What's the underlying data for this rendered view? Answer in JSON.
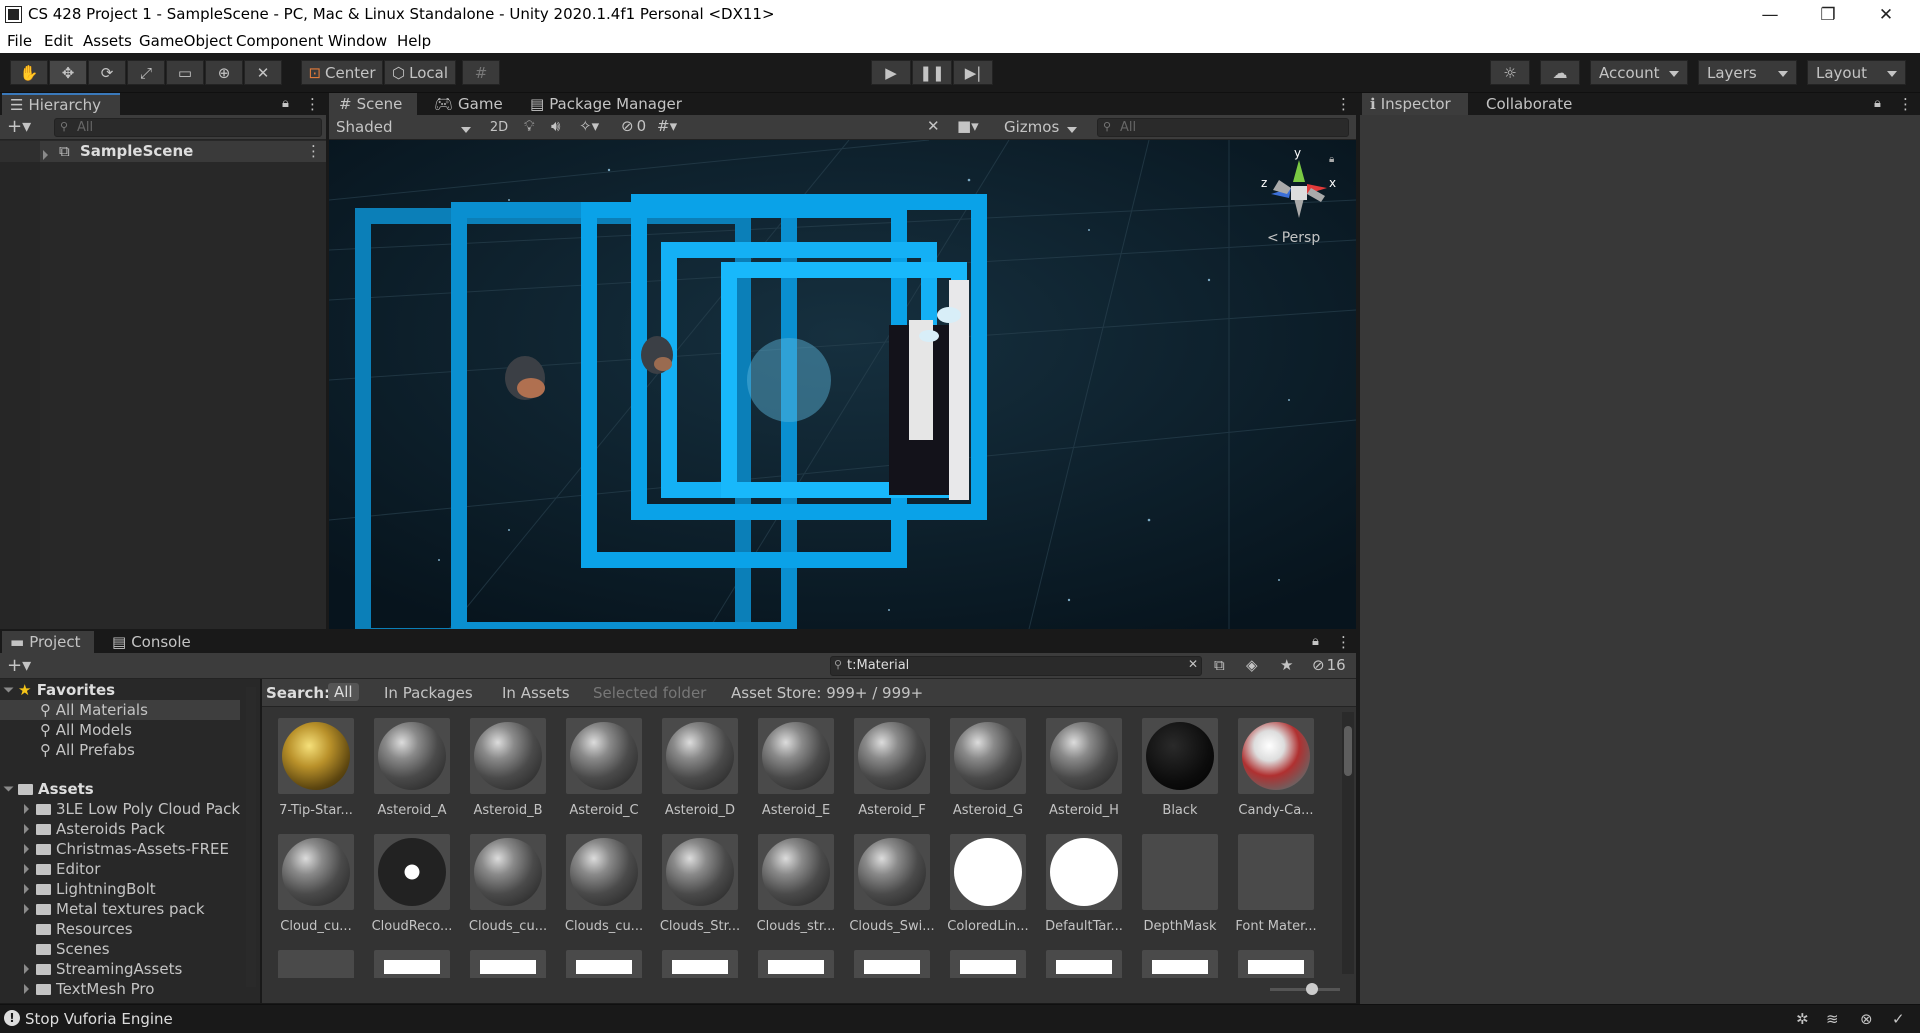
{
  "window": {
    "title": "CS 428 Project 1 - SampleScene - PC, Mac & Linux Standalone - Unity 2020.1.4f1 Personal <DX11>",
    "minimize": "—",
    "maximize": "❐",
    "close": "✕"
  },
  "menu": [
    "File",
    "Edit",
    "Assets",
    "GameObject",
    "Component",
    "Window",
    "Help"
  ],
  "toolbar": {
    "pivot_label": "Center",
    "space_label": "Local",
    "account": "Account",
    "layers": "Layers",
    "layout": "Layout"
  },
  "hierarchy": {
    "tab": "Hierarchy",
    "search_placeholder": "All",
    "scene": "SampleScene"
  },
  "scene_tabs": [
    "Scene",
    "Game",
    "Package Manager"
  ],
  "scene_bar": {
    "shading": "Shaded",
    "mode2d": "2D",
    "hidden_count": "0",
    "gizmos": "Gizmos",
    "search_placeholder": "All"
  },
  "gizmo": {
    "y": "y",
    "x": "x",
    "z": "z",
    "persp": "Persp"
  },
  "inspector": {
    "tabs": [
      "Inspector",
      "Collaborate"
    ]
  },
  "project": {
    "tabs": [
      "Project",
      "Console"
    ],
    "search_value": "t:Material",
    "visible_count": "16",
    "search_label": "Search:",
    "filters": [
      "All",
      "In Packages",
      "In Assets",
      "Selected folder",
      "Asset Store: 999+ / 999+"
    ],
    "favorites_label": "Favorites",
    "favorites": [
      "All Materials",
      "All Models",
      "All Prefabs"
    ],
    "assets_label": "Assets",
    "folders": [
      "3LE Low Poly Cloud Pack",
      "Asteroids Pack",
      "Christmas-Assets-FREE",
      "Editor",
      "LightningBolt",
      "Metal textures pack",
      "Resources",
      "Scenes",
      "StreamingAssets",
      "TextMesh Pro"
    ],
    "row1": [
      "7-Tip-Star...",
      "Asteroid_A",
      "Asteroid_B",
      "Asteroid_C",
      "Asteroid_D",
      "Asteroid_E",
      "Asteroid_F",
      "Asteroid_G",
      "Asteroid_H",
      "Black",
      "Candy-Ca..."
    ],
    "row2": [
      "Cloud_cu...",
      "CloudReco...",
      "Clouds_cu...",
      "Clouds_cu...",
      "Clouds_Str...",
      "Clouds_str...",
      "Clouds_Swi...",
      "ColoredLin...",
      "DefaultTar...",
      "DepthMask",
      "Font Mater..."
    ]
  },
  "status": {
    "message": "Stop Vuforia Engine"
  },
  "colors": {
    "accent": "#3a79bb",
    "cyan": "#00a8ff",
    "bg": "#191919",
    "panel": "#282828"
  }
}
